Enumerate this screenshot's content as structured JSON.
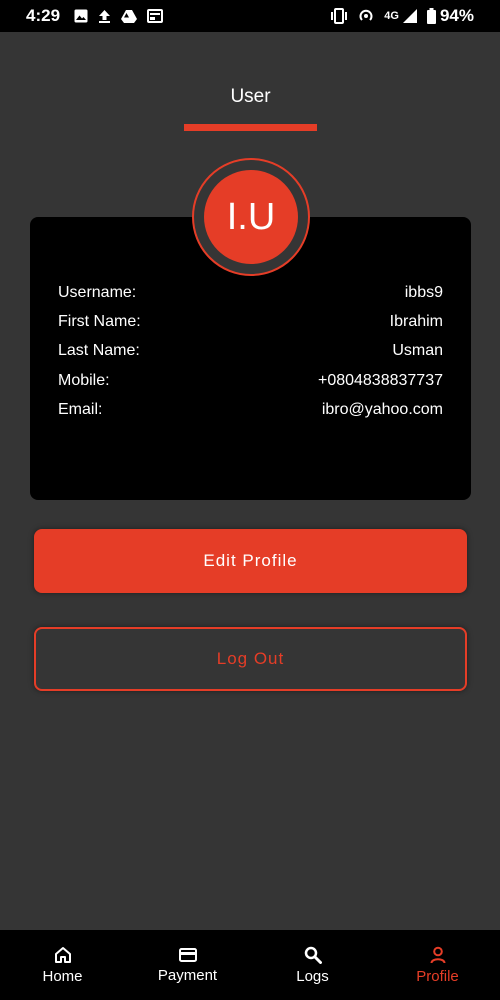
{
  "status_bar": {
    "time": "4:29",
    "network": "4G",
    "battery": "94%",
    "icons_left": [
      "image-icon",
      "upload-icon",
      "drive-icon",
      "news-icon"
    ],
    "icons_right": [
      "vibrate-icon",
      "hotspot-icon",
      "signal-icon",
      "battery-icon"
    ]
  },
  "header": {
    "tab_label": "User"
  },
  "profile": {
    "initials": "I.U",
    "fields": [
      {
        "label": "Username:",
        "value": "ibbs9"
      },
      {
        "label": "First Name:",
        "value": "Ibrahim"
      },
      {
        "label": "Last Name:",
        "value": "Usman"
      },
      {
        "label": "Mobile:",
        "value": "+0804838837737"
      },
      {
        "label": "Email:",
        "value": "ibro@yahoo.com"
      }
    ]
  },
  "actions": {
    "edit_label": "Edit Profile",
    "logout_label": "Log Out"
  },
  "bottom_nav": {
    "items": [
      {
        "label": "Home",
        "icon": "home-icon"
      },
      {
        "label": "Payment",
        "icon": "card-icon"
      },
      {
        "label": "Logs",
        "icon": "search-icon"
      },
      {
        "label": "Profile",
        "icon": "person-icon",
        "active": true
      }
    ]
  },
  "colors": {
    "accent": "#e53d27",
    "background": "#353535",
    "card": "#000000"
  }
}
